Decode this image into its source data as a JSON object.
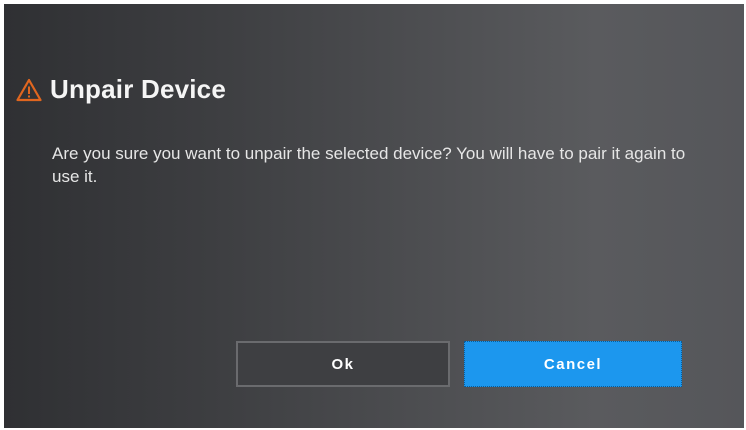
{
  "dialog": {
    "title": "Unpair Device",
    "icon": "warning-icon",
    "accent_color": "#e0661f",
    "message": "Are you sure you want to unpair the selected device? You will have to pair it again to use it.",
    "buttons": {
      "ok_label": "Ok",
      "cancel_label": "Cancel",
      "primary_color": "#1c97ee"
    }
  }
}
